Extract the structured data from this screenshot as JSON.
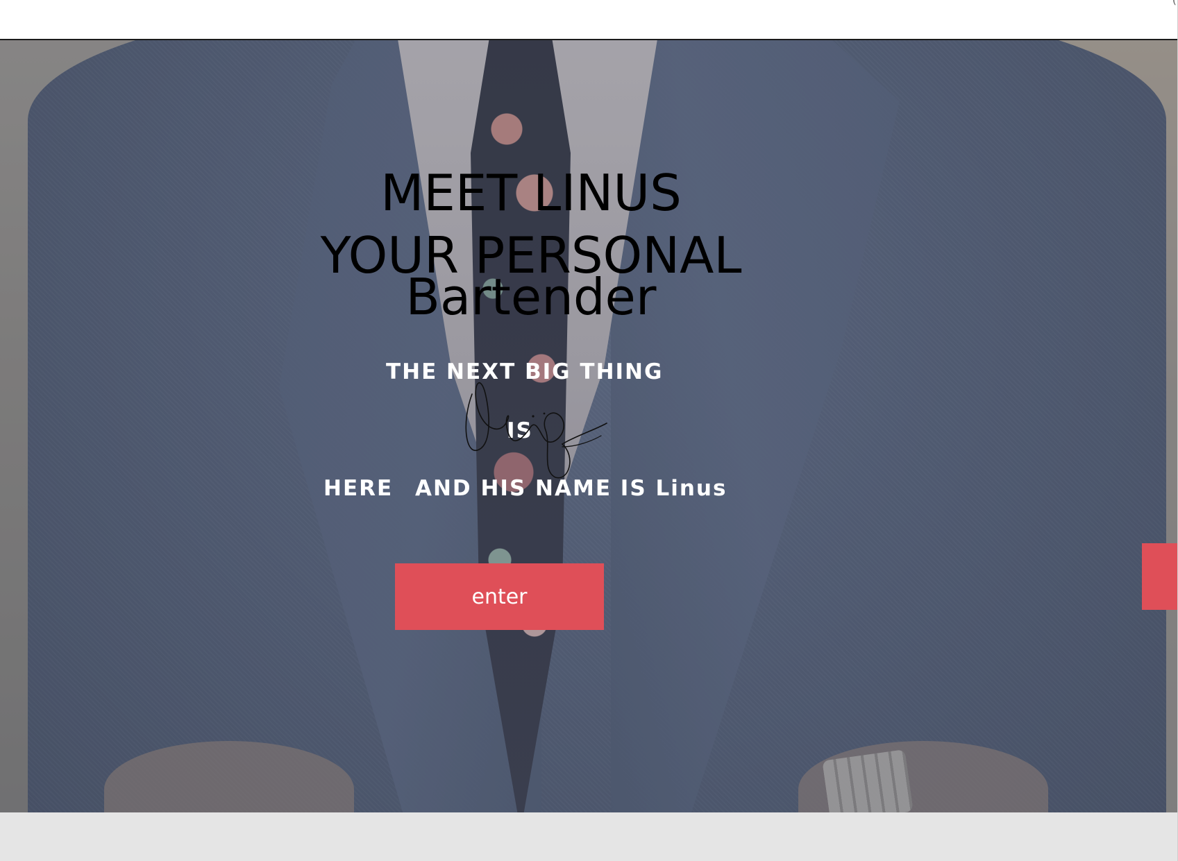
{
  "header": {
    "corner_glyph": "("
  },
  "hero": {
    "title_line1": "MEET LINUS",
    "title_line2": "YOUR PERSONAL",
    "title_line3": "Bartender",
    "tagline_line1": "THE NEXT BIG THING",
    "tagline_line2": "IS",
    "tagline_line3a": "HERE",
    "tagline_line3b": "AND HIS NAME IS Linus",
    "enter_label": "enter"
  },
  "colors": {
    "accent": "#df4f58",
    "footer": "#e5e5e5",
    "tagline": "#ffffff",
    "title": "#000000"
  },
  "icons": {
    "signature": "signature-icon"
  }
}
